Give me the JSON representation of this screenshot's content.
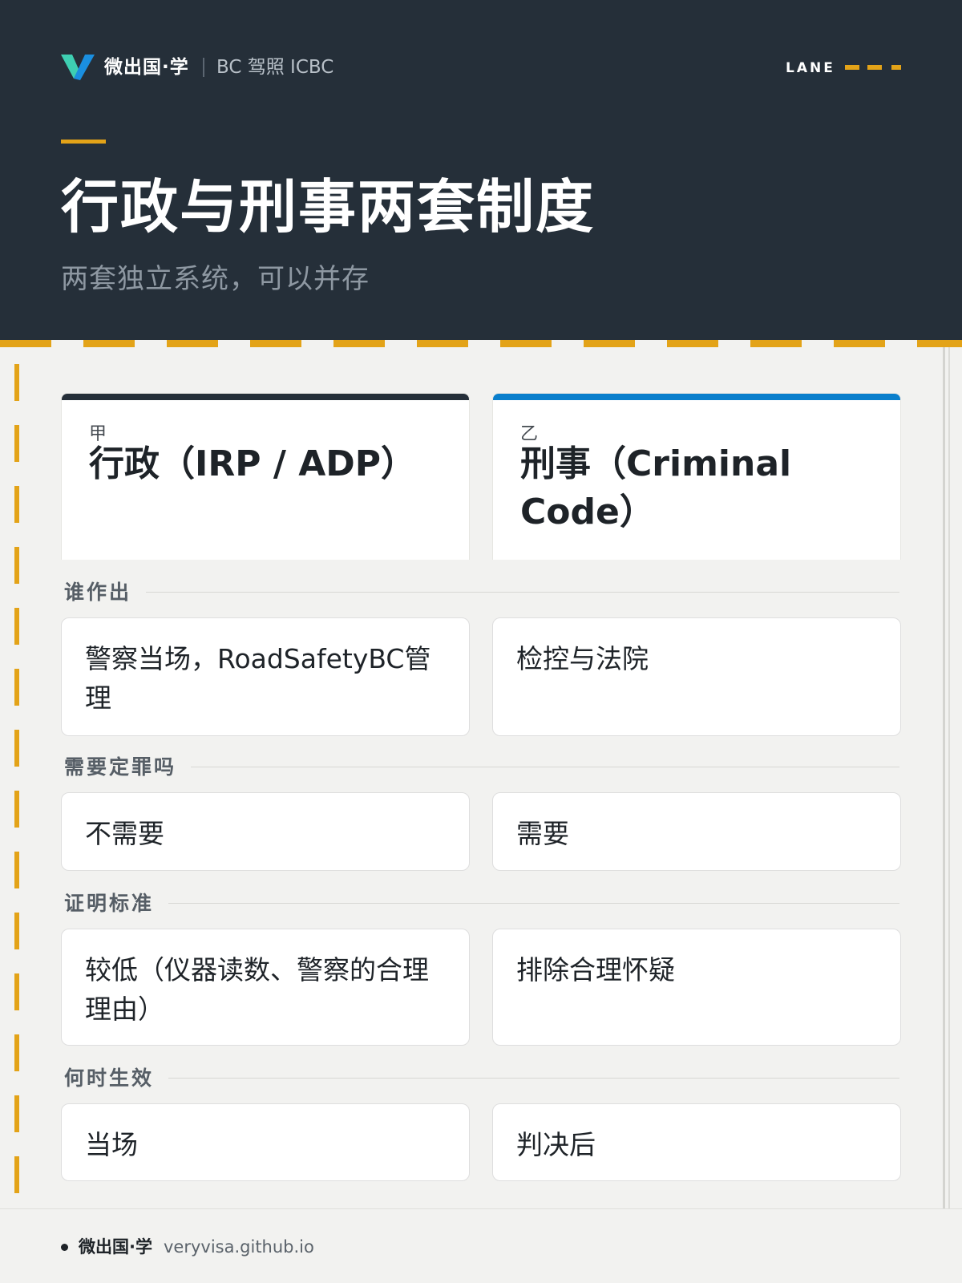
{
  "header": {
    "brand": "微出国·学",
    "brand_sub": "BC 驾照 ICBC",
    "lane_label": "LANE",
    "title": "行政与刑事两套制度",
    "subtitle": "两套独立系统，可以并存"
  },
  "columns": [
    {
      "tag": "甲",
      "name": "行政（IRP / ADP）",
      "color": "#252f39"
    },
    {
      "tag": "乙",
      "name": "刑事（Criminal Code）",
      "color": "#0a7fcc"
    }
  ],
  "rows": [
    {
      "label": "谁作出",
      "left": "警察当场，RoadSafetyBC管理",
      "right": "检控与法院"
    },
    {
      "label": "需要定罪吗",
      "left": "不需要",
      "right": "需要"
    },
    {
      "label": "证明标准",
      "left": "较低（仪器读数、警察的合理理由）",
      "right": "排除合理怀疑"
    },
    {
      "label": "何时生效",
      "left": "当场",
      "right": "判决后"
    }
  ],
  "footer": {
    "brand": "微出国·学",
    "url": "veryvisa.github.io"
  },
  "colors": {
    "accent": "#e3a318",
    "header_bg": "#252f39",
    "logo_teal": "#3ecfb2",
    "logo_blue": "#1a8fe0"
  }
}
